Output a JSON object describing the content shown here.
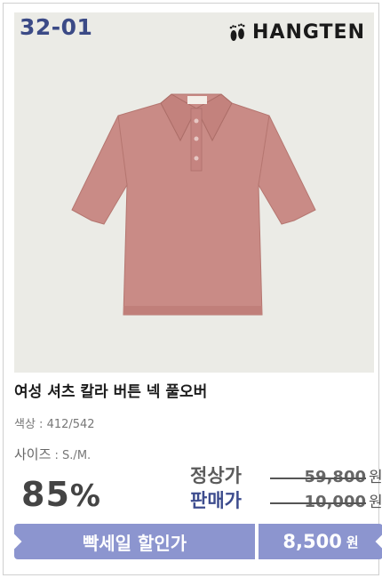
{
  "product": {
    "code": "32-01",
    "brand": "HANGTEN",
    "title": "여성 셔츠 칼라 버튼 넥 풀오버",
    "color_label": "색상",
    "color_value": " : 412/542",
    "size_label": "사이즈",
    "size_value": " : S./M.",
    "garment_color": "#c98b86"
  },
  "pricing": {
    "discount_number": "85",
    "discount_symbol": "%",
    "regular_label": "정상가",
    "regular_price": "59,800",
    "sale_label": "판매가",
    "sale_price": "10,000",
    "unit": "원"
  },
  "promo": {
    "label": "빡세일 할인가",
    "price": "8,500",
    "unit": "원",
    "bar_color": "#8c95cf"
  }
}
